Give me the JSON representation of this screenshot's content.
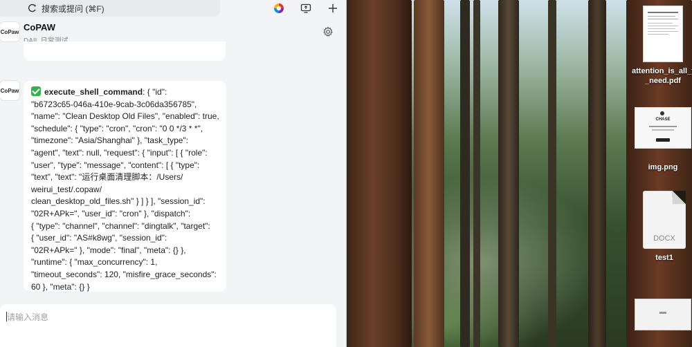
{
  "search": {
    "label": "搜索或提问 (⌘F)"
  },
  "app": {
    "name": "CoPAW",
    "subtitle": "DAIL 日常测试",
    "avatar_text": "CoPaw"
  },
  "message": {
    "tool_name": "execute_shell_command",
    "lines": [
      ": { \"id\":",
      "\"b6723c65-046a-410e-9cab-3c06da356785\",",
      "\"name\": \"Clean Desktop Old Files\", \"enabled\": true,",
      "\"schedule\": { \"type\": \"cron\", \"cron\": \"0 0 */3 * *\",",
      "\"timezone\": \"Asia/Shanghai\" }, \"task_type\":",
      "\"agent\", \"text\": null, \"request\": { \"input\": [ { \"role\":",
      "\"user\", \"type\": \"message\", \"content\": [ { \"type\":",
      "\"text\", \"text\": \"运行桌面清理脚本：/Users/",
      "weirui_test/.copaw/",
      "clean_desktop_old_files.sh\" } ] } ], \"session_id\":",
      "\"02R+APk=\", \"user_id\": \"cron\" }, \"dispatch\":",
      "{ \"type\": \"channel\", \"channel\": \"dingtalk\", \"target\":",
      "{ \"user_id\": \"AS#k8wg\", \"session_id\":",
      "\"02R+APk=\" }, \"mode\": \"final\", \"meta\": {} },",
      "\"runtime\": { \"max_concurrency\": 1,",
      "\"timeout_seconds\": 120, \"misfire_grace_seconds\":",
      "60 }, \"meta\": {} }"
    ]
  },
  "input": {
    "placeholder": "请输入消息"
  },
  "desktop": {
    "files": [
      {
        "label": "attention_is_all_y\n_need.pdf",
        "icon": "pdf-document-icon"
      },
      {
        "label": "img.png",
        "icon": "image-thumbnail-icon",
        "thumb_title": "CHASE"
      },
      {
        "label": "test1",
        "icon": "docx-document-icon",
        "badge": "DOCX"
      },
      {
        "label": "",
        "icon": "image-thumbnail-icon"
      }
    ]
  },
  "colors": {
    "check": "#36b24a",
    "window_bg": "#f3f4f6"
  }
}
